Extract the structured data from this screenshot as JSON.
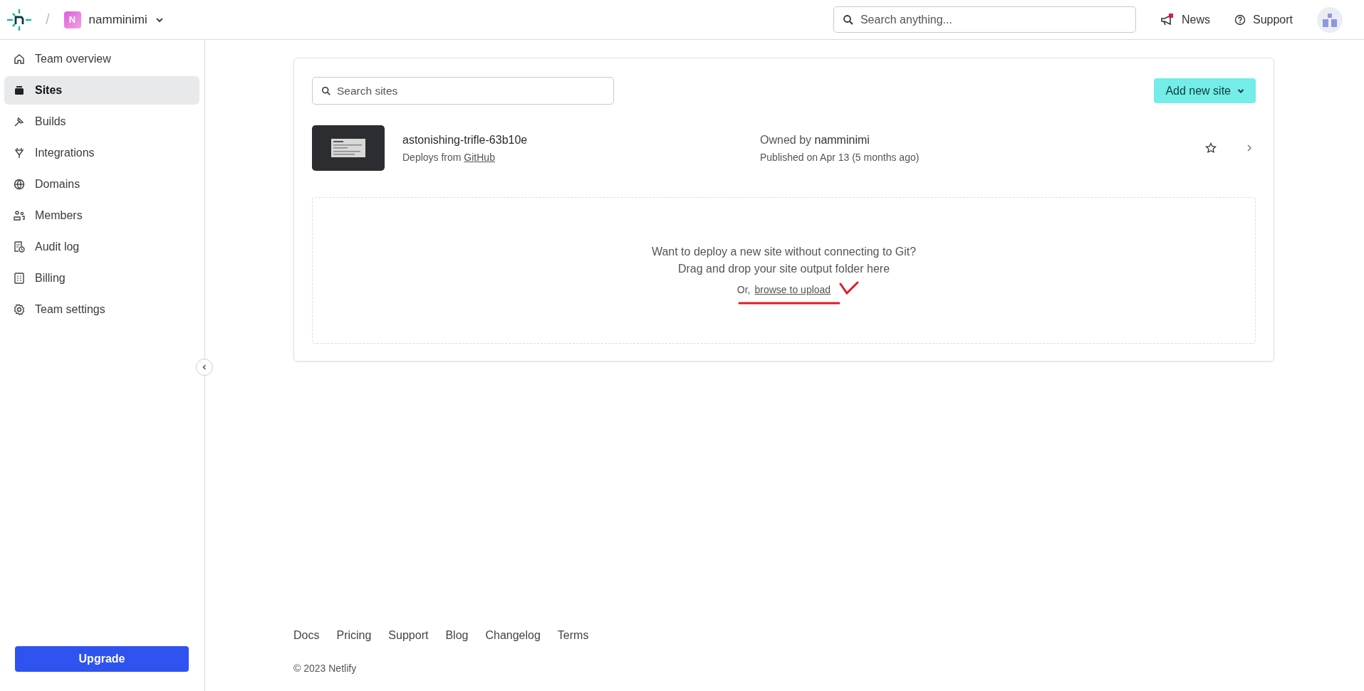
{
  "header": {
    "separator": "/",
    "team": {
      "initial": "N",
      "name": "namminimi"
    },
    "search": {
      "placeholder": "Search anything..."
    },
    "news": {
      "label": "News",
      "unread": true
    },
    "support": {
      "label": "Support"
    }
  },
  "sidebar": {
    "items": [
      {
        "label": "Team overview",
        "kind": "home",
        "selected": false
      },
      {
        "label": "Sites",
        "kind": "sites",
        "selected": true
      },
      {
        "label": "Builds",
        "kind": "builds",
        "selected": false
      },
      {
        "label": "Integrations",
        "kind": "plug",
        "selected": false
      },
      {
        "label": "Domains",
        "kind": "globe",
        "selected": false
      },
      {
        "label": "Members",
        "kind": "people",
        "selected": false
      },
      {
        "label": "Audit log",
        "kind": "audit",
        "selected": false
      },
      {
        "label": "Billing",
        "kind": "billing",
        "selected": false
      },
      {
        "label": "Team settings",
        "kind": "gear",
        "selected": false
      }
    ],
    "upgrade": "Upgrade"
  },
  "sites": {
    "search": {
      "placeholder": "Search sites"
    },
    "add_button": "Add new site",
    "list": [
      {
        "name": "astonishing-trifle-63b10e",
        "deploys_from": "Deploys from",
        "source": "GitHub",
        "owned_by": "Owned by",
        "owner": "namminimi",
        "published": "Published on Apr 13 (5 months ago)",
        "starred": false
      }
    ]
  },
  "dropzone": {
    "title": "Want to deploy a new site without connecting to Git?",
    "subtitle": "Drag and drop your site output folder here",
    "or": "Or,",
    "link": "browse to upload"
  },
  "footer": {
    "links": [
      "Docs",
      "Pricing",
      "Support",
      "Blog",
      "Changelog",
      "Terms"
    ],
    "copyright": "© 2023 Netlify"
  }
}
